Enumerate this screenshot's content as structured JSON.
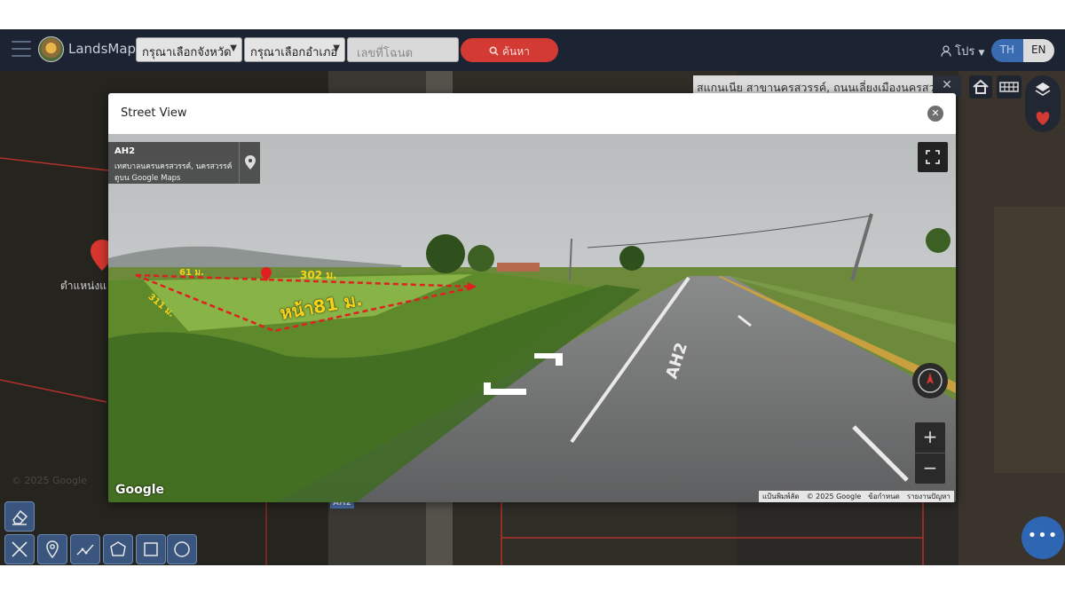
{
  "nav": {
    "brand": "LandsMaps",
    "province_select": "กรุณาเลือกจังหวัด",
    "district_select": "กรุณาเลือกอำเภอ",
    "deed_placeholder": "เลขที่โฉนด",
    "search_label": "ค้นหา",
    "user_label": "โปร",
    "lang_th": "TH",
    "lang_en": "EN"
  },
  "map": {
    "address_text": "สแกนเนีย สาขานครสวรรค์, ถนนเลี่ยงเมืองนครสวรรค์",
    "left_label": "ตำแหน่งแ",
    "road_label": "AH2",
    "faint_copyright": "© 2025 Google"
  },
  "modal": {
    "title": "Street View",
    "info_road": "AH2",
    "info_place": "เทศบาลนครนครสวรรค์, นครสวรรค์",
    "info_link": "ดูบน Google Maps",
    "google_logo": "Google",
    "overlay_front": "หน้า81 ม.",
    "overlay_top_left": "61 ม.",
    "overlay_top_right": "302 ม.",
    "overlay_side": "311 ม.",
    "road_marking": "AH2",
    "attribution": [
      "แป้นพิมพ์ลัด",
      "© 2025 Google",
      "ข้อกำหนด",
      "รายงานปัญหา"
    ],
    "zoom_in": "+",
    "zoom_out": "−"
  },
  "colors": {
    "nav_bg": "#1c2433",
    "search_button": "#d33a33",
    "lang_active": "#3a6bb0",
    "fab": "#2f66b3",
    "overlay_yellow": "#f6d31a",
    "boundary_red": "#e02020"
  }
}
